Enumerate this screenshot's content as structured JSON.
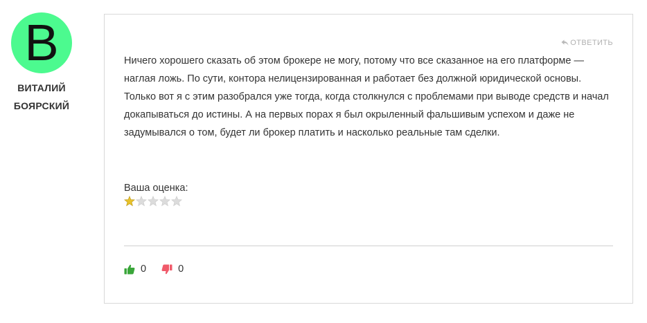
{
  "author": {
    "initial": "B",
    "avatar_color": "#4cfa8f",
    "name_line1": "ВИТАЛИЙ",
    "name_line2": "БОЯРСКИЙ"
  },
  "comment": {
    "reply_label": "ОТВЕТИТЬ",
    "text": "Ничего хорошего сказать об этом брокере не могу, потому что все сказанное на его платформе — наглая ложь. По сути, контора нелицензированная и работает без должной юридической основы. Только вот я с этим разобрался уже тогда, когда столкнулся с проблемами при выводе средств и начал докапываться до истины. А на первых порах я был окрыленный фальшивым успехом и даже не задумывался о том, будет ли брокер платить и насколько реальные там сделки.",
    "rating_label": "Ваша оценка:",
    "rating": 1,
    "rating_max": 5,
    "likes": "0",
    "dislikes": "0"
  },
  "colors": {
    "like": "#3aa63a",
    "dislike": "#f05a6a",
    "star_filled": "#e8c22a",
    "star_empty": "#dcdcdc"
  },
  "icons": {
    "reply": "reply-arrow-icon",
    "like": "thumbs-up-icon",
    "dislike": "thumbs-down-icon",
    "star": "star-icon"
  }
}
